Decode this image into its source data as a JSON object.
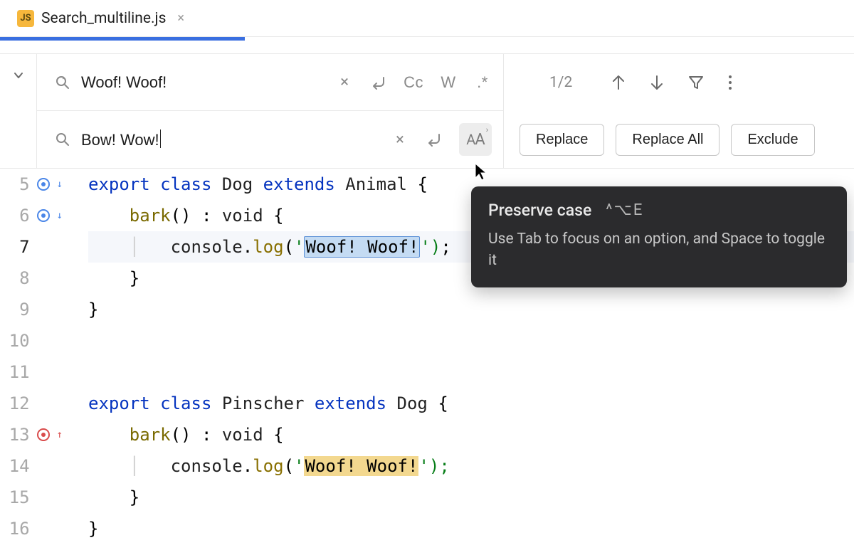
{
  "tab": {
    "badge": "JS",
    "title": "Search_multiline.js"
  },
  "search": {
    "find_value": "Woof! Woof!",
    "replace_value": "Bow! Wow!",
    "match_case_label": "Cc",
    "words_label": "W",
    "regex_label": ".*",
    "counter": "1/2"
  },
  "buttons": {
    "replace": "Replace",
    "replace_all": "Replace All",
    "exclude": "Exclude"
  },
  "tooltip": {
    "title": "Preserve case",
    "shortcut": "^⌥E",
    "body": "Use Tab to focus on an option, and Space to toggle it"
  },
  "code": {
    "lines": [
      "5",
      "6",
      "7",
      "8",
      "9",
      "10",
      "11",
      "12",
      "13",
      "14",
      "15",
      "16"
    ],
    "l5_export": "export",
    "l5_class": "class",
    "l5_dog": "Dog",
    "l5_extends": "extends",
    "l5_animal": "Animal",
    "l5_brace": "{",
    "l6_bark": "bark",
    "l6_void": "void",
    "l6_rest": "() :",
    "l7_console": "console",
    "l7_log": "log",
    "l7_str": "Woof! Woof!",
    "l7_tail": "')",
    "l8_brace": "}",
    "l9_brace": "}",
    "l12_export": "export",
    "l12_class": "class",
    "l12_pin": "Pinscher",
    "l12_extends": "extends",
    "l12_dog": "Dog",
    "l12_brace": "{",
    "l13_bark": "bark",
    "l13_void": "void",
    "l13_rest": "() :",
    "l14_console": "console",
    "l14_log": "log",
    "l14_str": "Woof! Woof!",
    "l14_tail": "');",
    "l15_brace": "}",
    "l16_brace": "}"
  }
}
